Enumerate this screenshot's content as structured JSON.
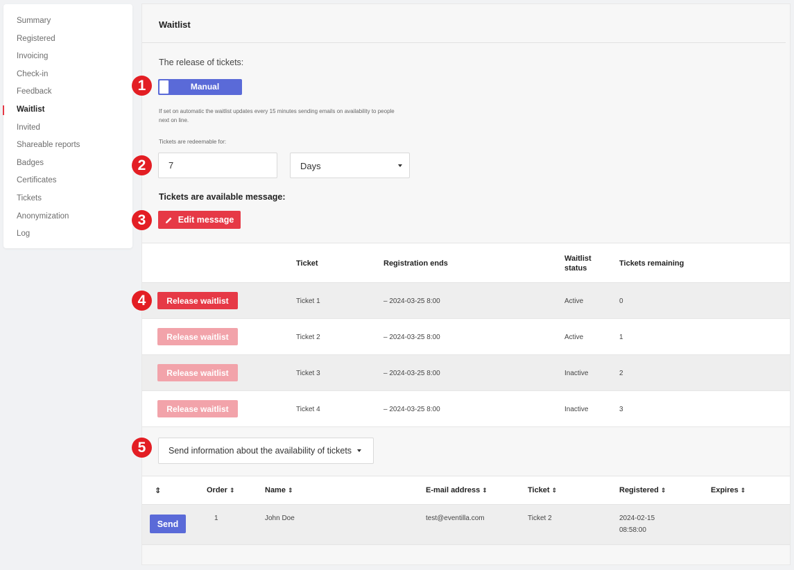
{
  "sidebar": {
    "items": [
      {
        "label": "Summary"
      },
      {
        "label": "Registered"
      },
      {
        "label": "Invoicing"
      },
      {
        "label": "Check-in"
      },
      {
        "label": "Feedback"
      },
      {
        "label": "Waitlist"
      },
      {
        "label": "Invited"
      },
      {
        "label": "Shareable reports"
      },
      {
        "label": "Badges"
      },
      {
        "label": "Certificates"
      },
      {
        "label": "Tickets"
      },
      {
        "label": "Anonymization"
      },
      {
        "label": "Log"
      }
    ],
    "active_item": "Waitlist"
  },
  "page": {
    "title": "Waitlist"
  },
  "release": {
    "label": "The release of tickets:",
    "toggle_label": "Manual",
    "hint": "If set on automatic the waitlist updates every 15 minutes sending emails on availability to people next on line."
  },
  "redeem": {
    "label": "Tickets are redeemable for:",
    "value": "7",
    "unit": "Days"
  },
  "message": {
    "label": "Tickets are available message:",
    "edit_button": "Edit message"
  },
  "tickets_table": {
    "headers": {
      "ticket": "Ticket",
      "registration_ends": "Registration ends",
      "waitlist_status": "Waitlist status",
      "tickets_remaining": "Tickets remaining"
    },
    "rows": [
      {
        "button": "Release waitlist",
        "ticket": "Ticket 1",
        "registration_ends": "– 2024-03-25 8:00",
        "status": "Active",
        "remaining": "0"
      },
      {
        "button": "Release waitlist",
        "ticket": "Ticket 2",
        "registration_ends": "– 2024-03-25 8:00",
        "status": "Active",
        "remaining": "1"
      },
      {
        "button": "Release waitlist",
        "ticket": "Ticket 3",
        "registration_ends": "– 2024-03-25 8:00",
        "status": "Inactive",
        "remaining": "2"
      },
      {
        "button": "Release waitlist",
        "ticket": "Ticket 4",
        "registration_ends": "– 2024-03-25 8:00",
        "status": "Inactive",
        "remaining": "3"
      }
    ]
  },
  "send_info_button": "Send information about the availability of tickets",
  "people_table": {
    "headers": {
      "order": "Order",
      "name": "Name",
      "email": "E-mail address",
      "ticket": "Ticket",
      "registered": "Registered",
      "expires": "Expires"
    },
    "rows": [
      {
        "button": "Send",
        "order": "1",
        "name": "John Doe",
        "email": "test@eventilla.com",
        "ticket": "Ticket 2",
        "registered_date": "2024-02-15",
        "registered_time": "08:58:00",
        "expires": ""
      }
    ]
  },
  "markers": [
    "1",
    "2",
    "3",
    "4",
    "5"
  ],
  "colors": {
    "primary": "#5a6ad8",
    "danger": "#e63946",
    "danger_disabled": "#f2a3aa",
    "marker": "#e31e24"
  }
}
